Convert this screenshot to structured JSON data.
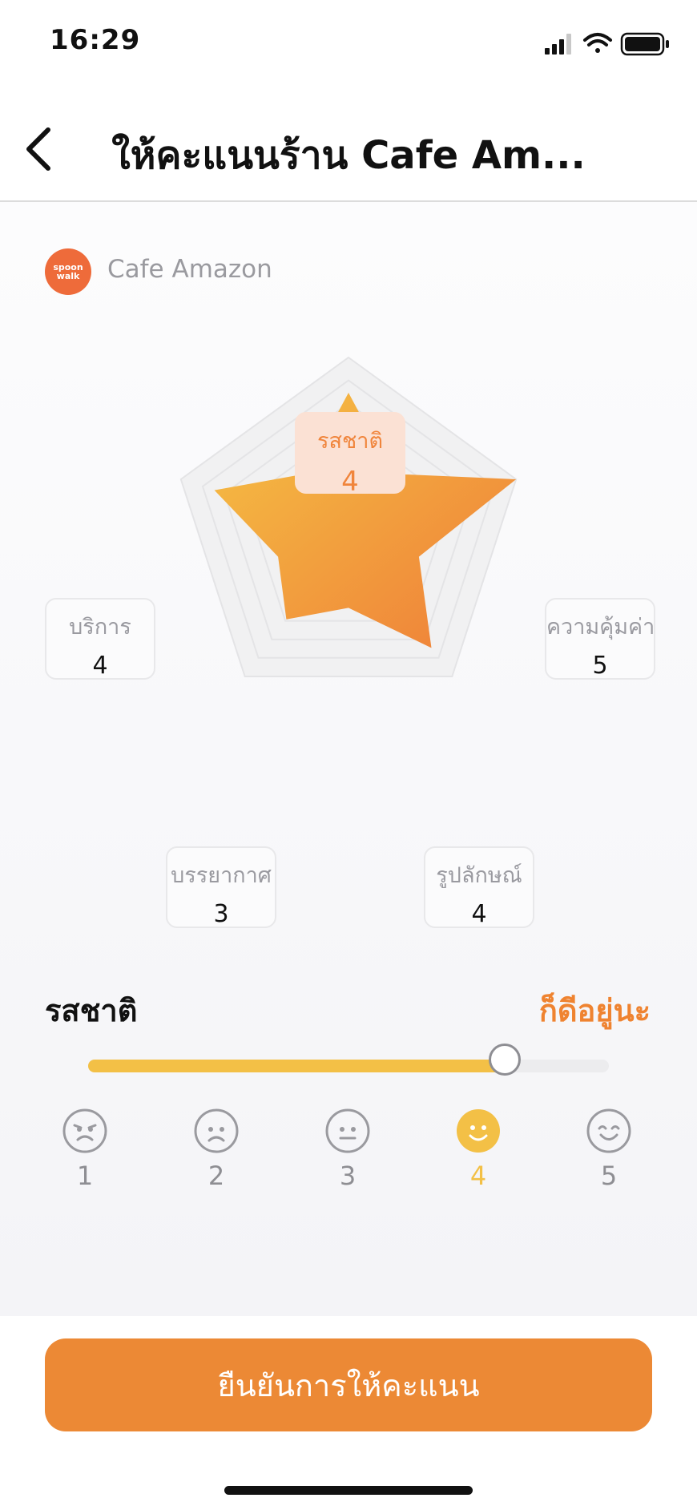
{
  "status_bar": {
    "time": "16:29",
    "signal_icon": "cellular-signal-icon",
    "wifi_icon": "wifi-icon",
    "battery_icon": "battery-icon"
  },
  "header": {
    "back_icon": "chevron-left-icon",
    "title": "ให้คะแนนร้าน Cafe Am..."
  },
  "shop": {
    "logo_text": "spoon walk",
    "name": "Cafe Amazon"
  },
  "ratings": {
    "taste": {
      "label": "รสชาติ",
      "value": 4
    },
    "value": {
      "label": "ความคุ้มค่า",
      "value": 5
    },
    "appearance": {
      "label": "รูปลักษณ์",
      "value": 4
    },
    "atmosphere": {
      "label": "บรรยากาศ",
      "value": 3
    },
    "service": {
      "label": "บริการ",
      "value": 4
    },
    "max": 5
  },
  "selected_category": {
    "title": "รสชาติ",
    "description": "ก็ดีอยู่นะ",
    "slider_value": 4,
    "slider_max": 5
  },
  "faces": [
    {
      "num": "1",
      "icon": "angry-face-icon"
    },
    {
      "num": "2",
      "icon": "sad-face-icon"
    },
    {
      "num": "3",
      "icon": "neutral-face-icon"
    },
    {
      "num": "4",
      "icon": "smile-face-icon"
    },
    {
      "num": "5",
      "icon": "happy-face-icon"
    }
  ],
  "colors": {
    "accent": "#ec8935",
    "highlight": "#f3c046",
    "star_start": "#f5c244",
    "star_end": "#ef7d38"
  },
  "confirm_button": {
    "label": "ยืนยันการให้คะแนน"
  }
}
